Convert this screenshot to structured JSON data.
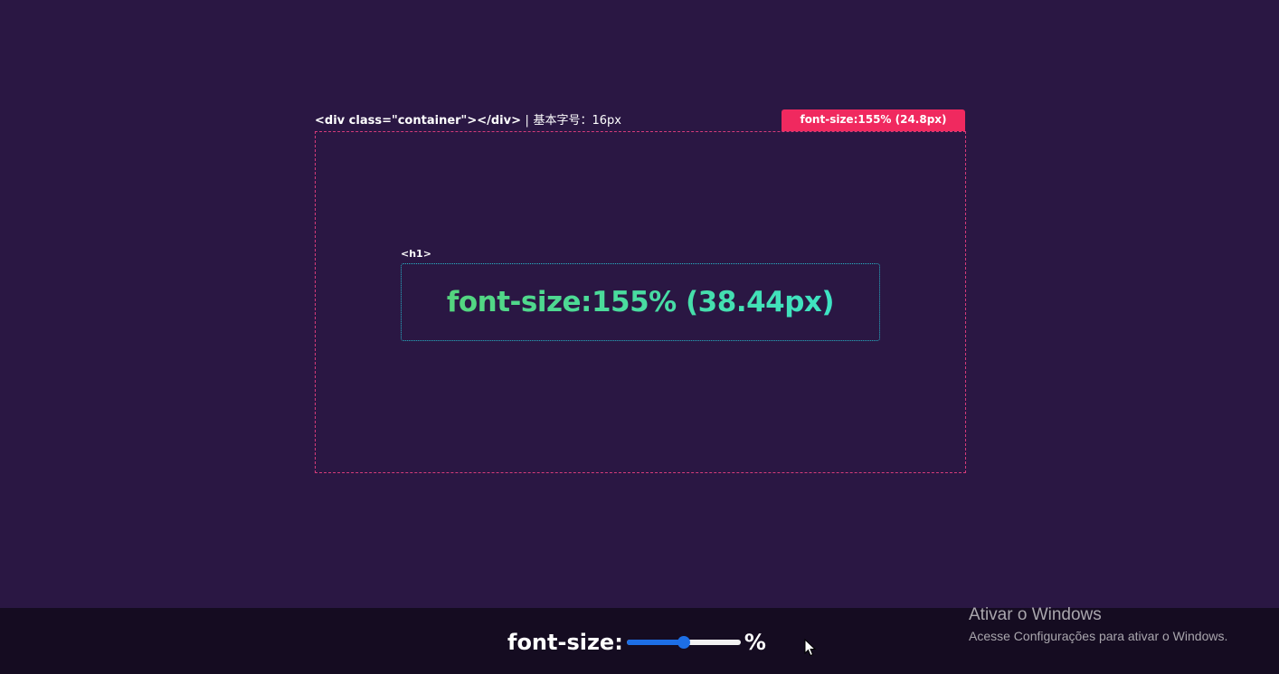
{
  "container": {
    "tag_label": "<div class=\"container\"></div>",
    "separator": "|",
    "base_size_label": "基本字号：16px",
    "badge": "font-size:155% (24.8px)"
  },
  "heading": {
    "tag_label": "<h1>",
    "text": "font-size:155% (38.44px)"
  },
  "control": {
    "label": "font-size:",
    "unit": "%",
    "slider_value_fraction": 0.5
  },
  "windows_notice": {
    "title": "Ativar o Windows",
    "subtitle": "Acesse Configurações para ativar o Windows."
  },
  "colors": {
    "background": "#2a1743",
    "bottom_bar": "#150c21",
    "badge": "#f0295f",
    "container_border": "#d63b7a",
    "h1_border": "#27b6c9",
    "slider_accent": "#1d6fe6"
  },
  "icons": {
    "cursor": "mouse-pointer-icon"
  }
}
